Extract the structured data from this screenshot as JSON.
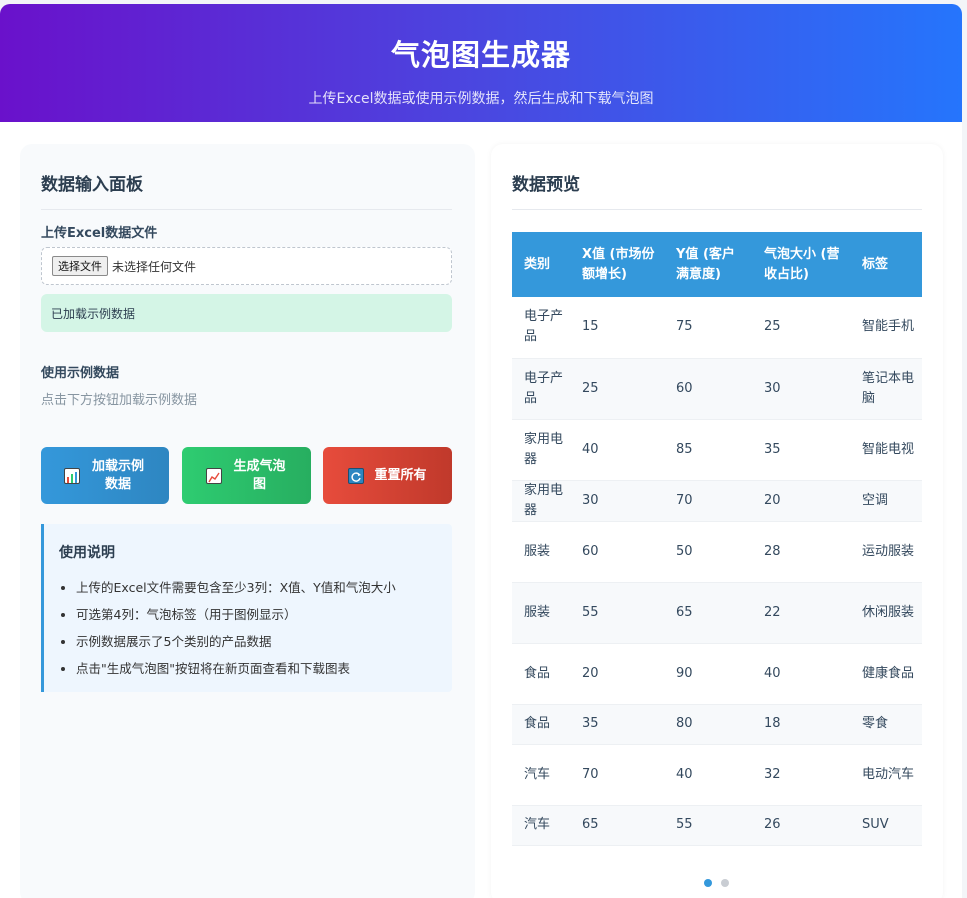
{
  "header": {
    "title": "气泡图生成器",
    "subtitle": "上传Excel数据或使用示例数据，然后生成和下载气泡图"
  },
  "input_panel": {
    "title": "数据输入面板",
    "upload_label": "上传Excel数据文件",
    "file_button": "选择文件",
    "file_status": "未选择任何文件",
    "load_status": "已加载示例数据",
    "sample_label": "使用示例数据",
    "sample_hint": "点击下方按钮加载示例数据",
    "buttons": {
      "load": "加载示例数据",
      "generate": "生成气泡图",
      "reset": "重置所有"
    },
    "instructions": {
      "title": "使用说明",
      "items": [
        "上传的Excel文件需要包含至少3列：X值、Y值和气泡大小",
        "可选第4列：气泡标签（用于图例显示）",
        "示例数据展示了5个类别的产品数据",
        "点击\"生成气泡图\"按钮将在新页面查看和下载图表"
      ]
    }
  },
  "preview_panel": {
    "title": "数据预览",
    "columns": [
      "类别",
      "X值 (市场份额增长)",
      "Y值 (客户满意度)",
      "气泡大小 (营收占比)",
      "标签"
    ],
    "rows": [
      [
        "电子产品",
        "15",
        "75",
        "25",
        "智能手机"
      ],
      [
        "电子产品",
        "25",
        "60",
        "30",
        "笔记本电脑"
      ],
      [
        "家用电器",
        "40",
        "85",
        "35",
        "智能电视"
      ],
      [
        "家用电器",
        "30",
        "70",
        "20",
        "空调"
      ],
      [
        "服装",
        "60",
        "50",
        "28",
        "运动服装"
      ],
      [
        "服装",
        "55",
        "65",
        "22",
        "休闲服装"
      ],
      [
        "食品",
        "20",
        "90",
        "40",
        "健康食品"
      ],
      [
        "食品",
        "35",
        "80",
        "18",
        "零食"
      ],
      [
        "汽车",
        "70",
        "40",
        "32",
        "电动汽车"
      ],
      [
        "汽车",
        "65",
        "55",
        "26",
        "SUV"
      ]
    ],
    "pagination": {
      "pages": 2,
      "current": 1
    }
  },
  "colors": {
    "header_start": "#6a11cb",
    "header_end": "#2575fc",
    "blue": "#3498db",
    "green": "#2ecc71",
    "red": "#e74c3c"
  },
  "icons": {
    "load": "bar-chart-icon",
    "generate": "line-chart-icon",
    "reset": "refresh-icon"
  }
}
